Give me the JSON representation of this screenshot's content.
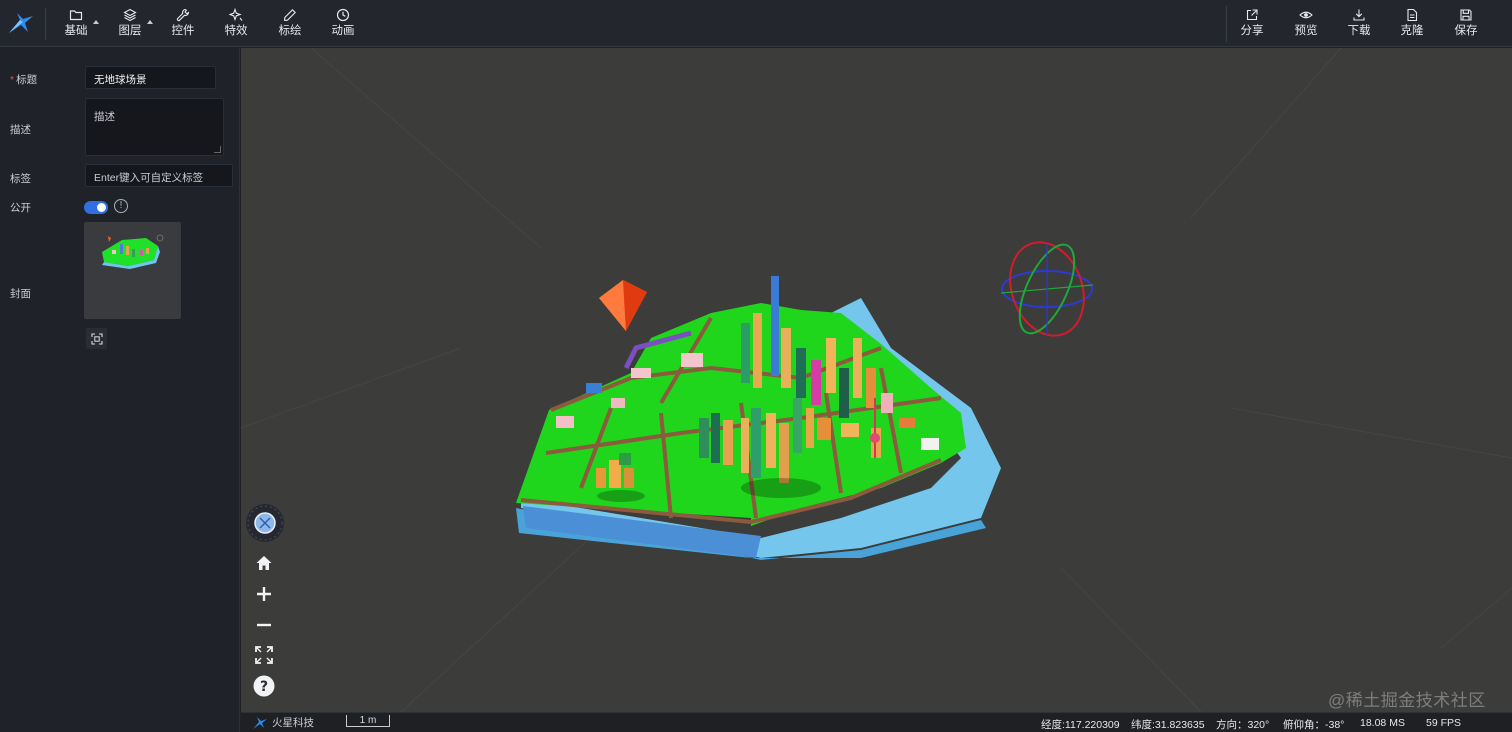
{
  "toolbar": {
    "left_tools": [
      {
        "label": "基础",
        "icon": "folder-icon",
        "has_dropdown": true
      },
      {
        "label": "图层",
        "icon": "layers-icon",
        "has_dropdown": true
      },
      {
        "label": "控件",
        "icon": "wrench-icon",
        "has_dropdown": false
      },
      {
        "label": "特效",
        "icon": "sparkle-icon",
        "has_dropdown": false
      },
      {
        "label": "标绘",
        "icon": "pen-icon",
        "has_dropdown": false
      },
      {
        "label": "动画",
        "icon": "clock-icon",
        "has_dropdown": false
      }
    ],
    "right_tools": [
      {
        "label": "分享",
        "icon": "share-icon"
      },
      {
        "label": "预览",
        "icon": "eye-icon"
      },
      {
        "label": "下载",
        "icon": "download-icon"
      },
      {
        "label": "克隆",
        "icon": "clone-icon"
      },
      {
        "label": "保存",
        "icon": "save-icon"
      }
    ]
  },
  "form": {
    "title_label": "标题",
    "title_value": "无地球场景",
    "desc_label": "描述",
    "desc_placeholder": "描述",
    "tags_label": "标签",
    "tags_placeholder": "Enter键入可自定义标签",
    "public_label": "公开",
    "public_on": true,
    "cover_label": "封面"
  },
  "status": {
    "brand": "火星科技",
    "scale": "1 m",
    "longitude": "经度:117.220309",
    "latitude": "纬度:31.823635",
    "heading": "方向：320°",
    "pitch": "俯仰角：-38°",
    "frame_time": "18.08 MS",
    "fps": "59 FPS"
  },
  "watermark": "@稀土掘金技术社区",
  "colors": {
    "accent": "#2f6fe0",
    "ground": "#17d917",
    "water": "#7fd0f0",
    "viewport_bg": "#3c3c3b"
  }
}
